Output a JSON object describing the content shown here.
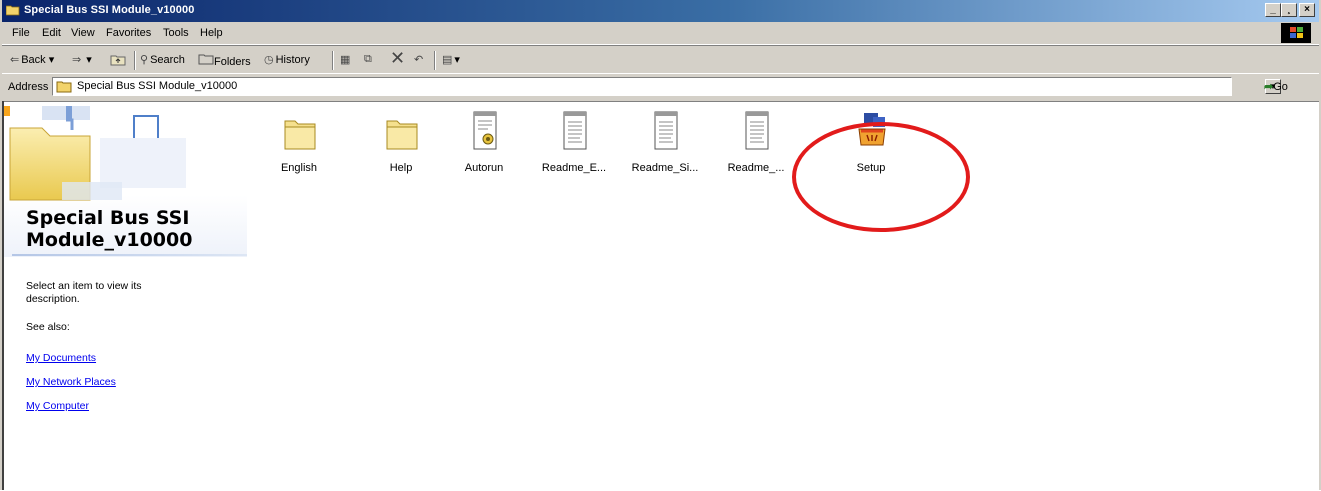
{
  "window": {
    "title": "Special Bus SSI Module_v10000",
    "controls": [
      "_",
      "¸",
      "×"
    ]
  },
  "menu": {
    "items": [
      "File",
      "Edit",
      "View",
      "Favorites",
      "Tools",
      "Help"
    ]
  },
  "toolbar": {
    "back_label": "Back",
    "back_dropdown": "▾",
    "forward_dropdown": "▾",
    "search_label": "Search",
    "folders_label": "Folders",
    "history_label": "History",
    "views_dropdown": "▾"
  },
  "address": {
    "label": "Address",
    "value": "Special Bus SSI Module_v10000",
    "go_label": "Go"
  },
  "left_panel": {
    "folder_title": "Special Bus SSI Module_v10000",
    "description": "Select an item to view its description.",
    "see_also": "See also:",
    "links": [
      "My Documents",
      "My Network Places",
      "My Computer"
    ]
  },
  "items": [
    {
      "name": "English",
      "type": "folder"
    },
    {
      "name": "Help",
      "type": "folder"
    },
    {
      "name": "Autorun",
      "type": "setup-info"
    },
    {
      "name": "Readme_E...",
      "type": "text"
    },
    {
      "name": "Readme_Si...",
      "type": "text"
    },
    {
      "name": "Readme_...",
      "type": "text"
    },
    {
      "name": "Setup",
      "type": "setup-exe"
    }
  ],
  "colors": {
    "titlebar_start": "#0a246a",
    "titlebar_end": "#a6caf0",
    "chrome": "#d4d0c8",
    "highlight_circle": "#e21b1b",
    "link": "#0000ee"
  }
}
